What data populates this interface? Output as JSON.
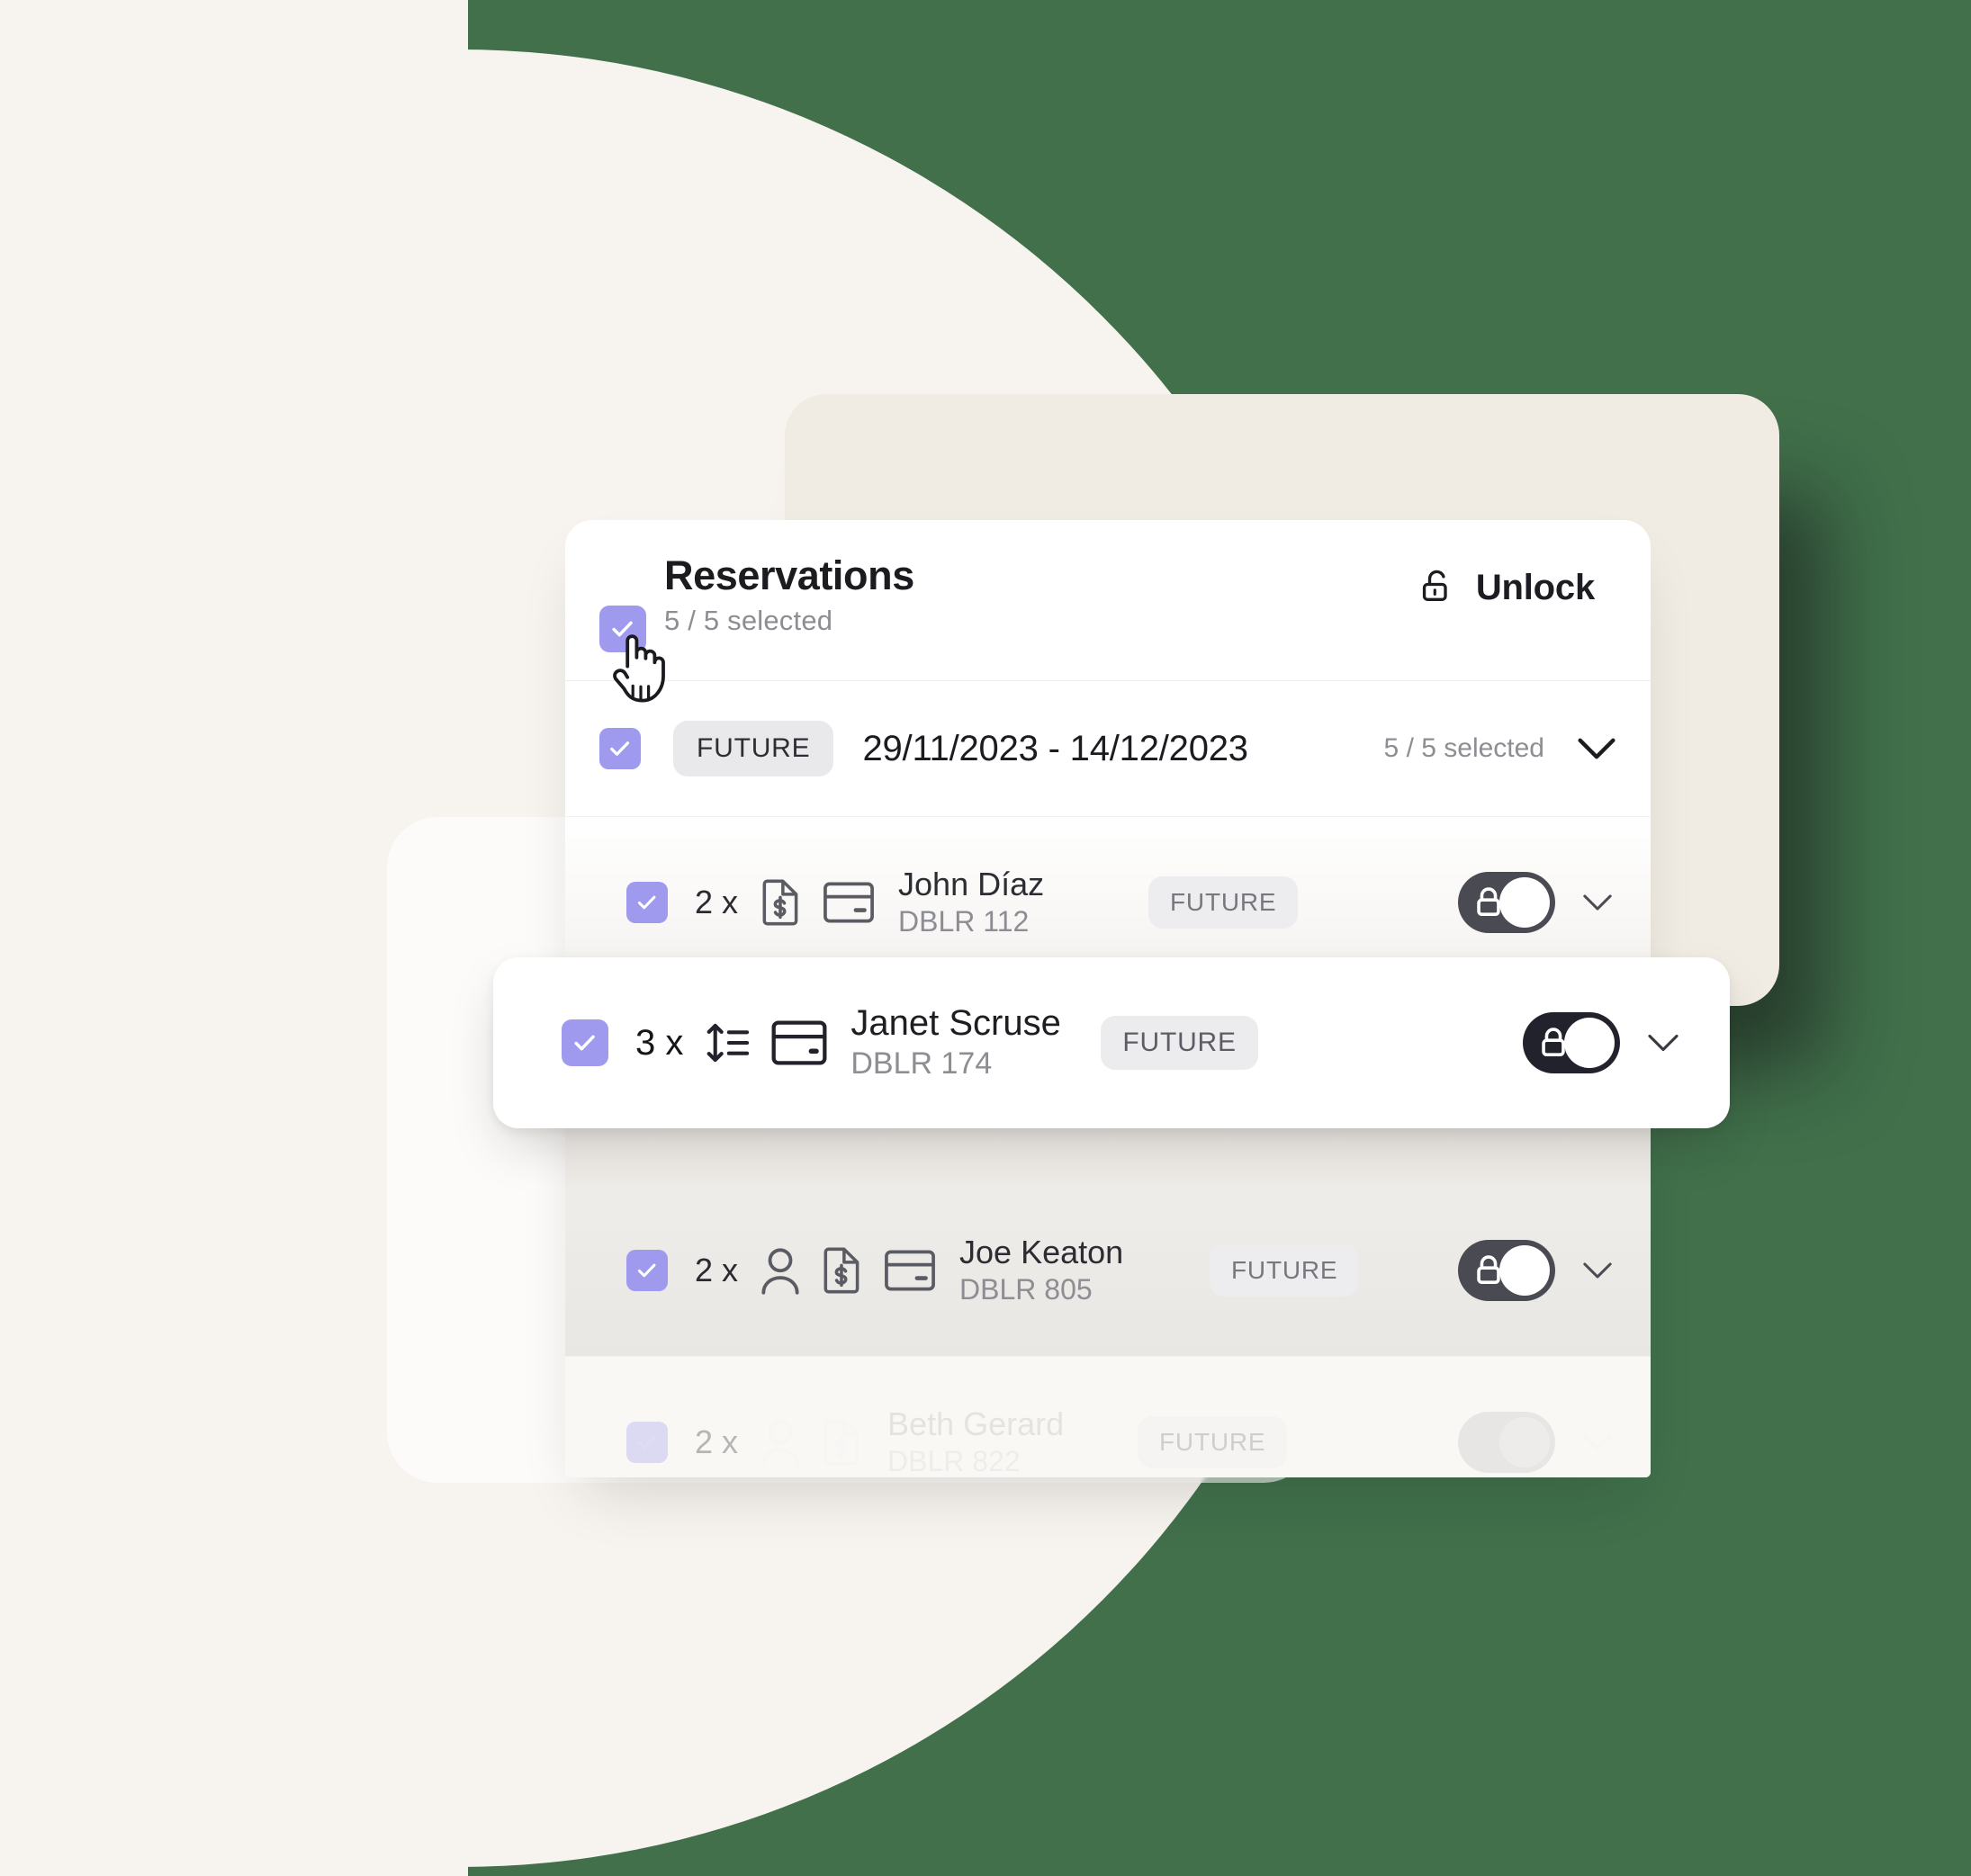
{
  "theme": {
    "accent_purple": "#9f9aee",
    "background_cream": "#f7f4ef",
    "card_back_cream": "#f0ece3",
    "card_white": "#ffffff",
    "badge_grey": "#e9e8ea",
    "toggle_dark": "#22222c",
    "toggle_dim": "#4a4a52",
    "text_dark": "#1c1c20",
    "text_muted": "#8d8d93"
  },
  "header": {
    "title": "Reservations",
    "selected_summary": "5 / 5 selected",
    "select_all_checked": true,
    "unlock_label": "Unlock",
    "unlock_icon": "unlock-open-icon",
    "cursor_icon": "pointing-hand-cursor"
  },
  "group": {
    "checked": true,
    "status_badge": "FUTURE",
    "date_range": "29/11/2023 - 14/12/2023",
    "selected_summary": "5 / 5 selected",
    "expand_icon": "chevron-down-icon"
  },
  "rows": [
    {
      "checked": true,
      "quantity": "2 x",
      "icons": [
        "invoice-dollar-icon",
        "credit-card-icon"
      ],
      "guest_name": "John Díaz",
      "room": "DBLR 112",
      "status_badge": "FUTURE",
      "lock_state": "locked",
      "toggle_tone": "dim",
      "expand_icon": "chevron-down-icon",
      "style": "shaded"
    },
    {
      "checked": true,
      "quantity": "3 x",
      "icons": [
        "height-rows-icon",
        "credit-card-icon"
      ],
      "guest_name": "Janet Scruse",
      "room": "DBLR 174",
      "status_badge": "FUTURE",
      "lock_state": "locked",
      "toggle_tone": "dark",
      "expand_icon": "chevron-down-icon",
      "style": "highlight"
    },
    {
      "checked": true,
      "quantity": "2 x",
      "icons": [
        "person-icon",
        "invoice-dollar-icon",
        "credit-card-icon"
      ],
      "guest_name": "Joe Keaton",
      "room": "DBLR 805",
      "status_badge": "FUTURE",
      "lock_state": "locked",
      "toggle_tone": "dim",
      "expand_icon": "chevron-down-icon",
      "style": "shaded"
    },
    {
      "checked": true,
      "quantity": "2 x",
      "icons": [
        "person-icon",
        "invoice-dollar-icon"
      ],
      "guest_name": "Beth Gerard",
      "room": "DBLR 822",
      "status_badge": "FUTURE",
      "lock_state": "locked",
      "toggle_tone": "dim",
      "expand_icon": "chevron-down-icon",
      "style": "faded"
    }
  ]
}
